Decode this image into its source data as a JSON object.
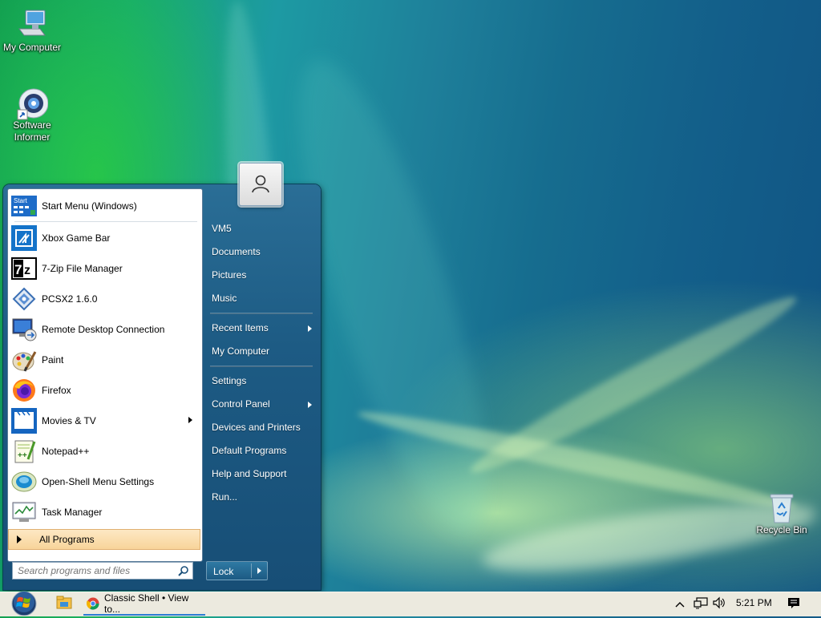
{
  "desktop": {
    "icons": [
      {
        "label": "My Computer",
        "icon": "computer-icon"
      },
      {
        "label": "Software Informer",
        "icon": "software-informer-icon"
      },
      {
        "label": "Recycle Bin",
        "icon": "recycle-bin-icon"
      }
    ]
  },
  "start_menu": {
    "programs": [
      {
        "label": "Start Menu (Windows)",
        "icon": "start-menu-icon"
      },
      {
        "label": "Xbox Game Bar",
        "icon": "xbox-game-bar-icon"
      },
      {
        "label": "7-Zip File Manager",
        "icon": "7zip-icon"
      },
      {
        "label": "PCSX2 1.6.0",
        "icon": "pcsx2-icon"
      },
      {
        "label": "Remote Desktop Connection",
        "icon": "remote-desktop-icon"
      },
      {
        "label": "Paint",
        "icon": "paint-icon"
      },
      {
        "label": "Firefox",
        "icon": "firefox-icon"
      },
      {
        "label": "Movies & TV",
        "icon": "movies-tv-icon",
        "has_submenu": true
      },
      {
        "label": "Notepad++",
        "icon": "notepadpp-icon"
      },
      {
        "label": "Open-Shell Menu Settings",
        "icon": "open-shell-icon"
      },
      {
        "label": "Task Manager",
        "icon": "task-manager-icon"
      }
    ],
    "all_programs_label": "All Programs",
    "search_placeholder": "Search programs and files",
    "right_items": [
      {
        "label": "VM5"
      },
      {
        "label": "Documents"
      },
      {
        "label": "Pictures"
      },
      {
        "label": "Music"
      },
      {
        "label": "Recent Items",
        "has_submenu": true
      },
      {
        "label": "My Computer"
      },
      {
        "label": "Settings"
      },
      {
        "label": "Control Panel",
        "has_submenu": true
      },
      {
        "label": "Devices and Printers"
      },
      {
        "label": "Default Programs"
      },
      {
        "label": "Help and Support"
      },
      {
        "label": "Run..."
      }
    ],
    "lock_label": "Lock"
  },
  "taskbar": {
    "task_title": "Classic Shell • View to...",
    "clock": "5:21 PM"
  },
  "colors": {
    "menu_panel": "#1d5b84",
    "all_programs_highlight": "#f8d49a",
    "taskbar": "#eceadf"
  }
}
